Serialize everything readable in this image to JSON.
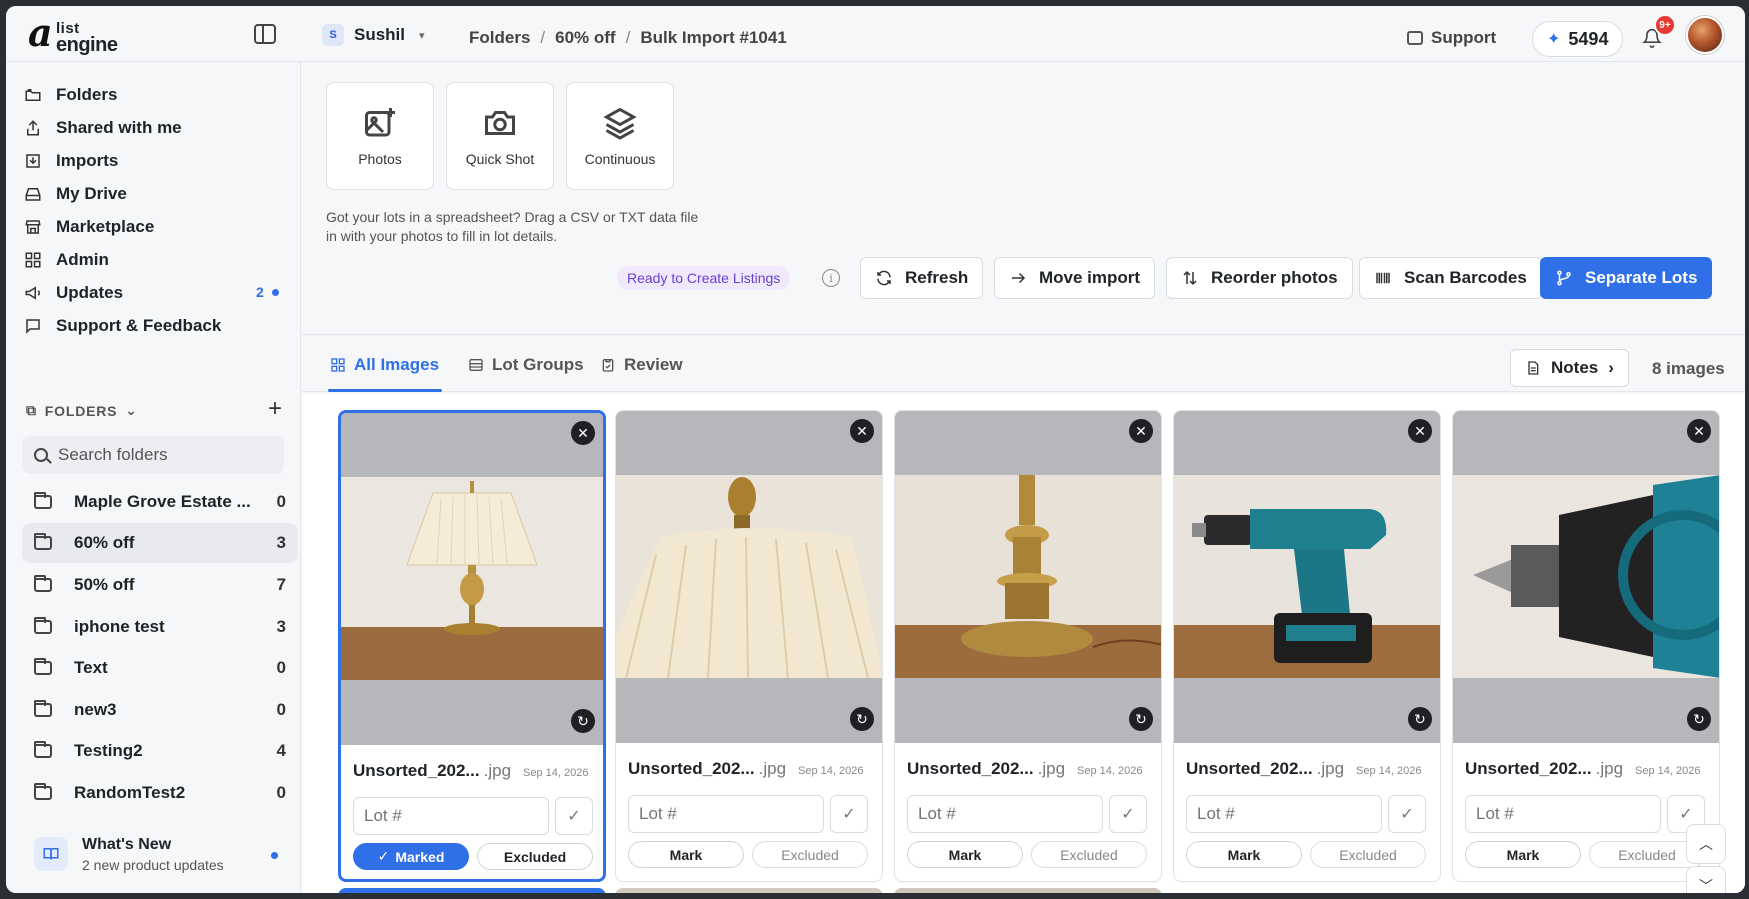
{
  "app": {
    "logo_top": "list",
    "logo_bottom": "engine",
    "logo_mark": "a"
  },
  "topbar": {
    "workspace_initial": "S",
    "workspace_name": "Sushil",
    "breadcrumb": [
      "Folders",
      "60% off",
      "Bulk Import #1041"
    ],
    "support_label": "Support",
    "credits": "5494",
    "notifications_badge": "9+"
  },
  "sidebar": {
    "nav": [
      {
        "label": "Folders",
        "icon": "folders-icon"
      },
      {
        "label": "Shared with me",
        "icon": "share-icon"
      },
      {
        "label": "Imports",
        "icon": "import-icon"
      },
      {
        "label": "My Drive",
        "icon": "drive-icon"
      },
      {
        "label": "Marketplace",
        "icon": "store-icon"
      },
      {
        "label": "Admin",
        "icon": "grid-icon"
      },
      {
        "label": "Updates",
        "icon": "megaphone-icon",
        "badge": "2"
      },
      {
        "label": "Support & Feedback",
        "icon": "chat-icon"
      }
    ],
    "folders_header": "FOLDERS",
    "search_placeholder": "Search folders",
    "folders": [
      {
        "name": "Maple Grove Estate ...",
        "count": "0"
      },
      {
        "name": "60% off",
        "count": "3",
        "active": true
      },
      {
        "name": "50% off",
        "count": "7"
      },
      {
        "name": "iphone test",
        "count": "3"
      },
      {
        "name": "Text",
        "count": "0"
      },
      {
        "name": "new3",
        "count": "0"
      },
      {
        "name": "Testing2",
        "count": "4"
      },
      {
        "name": "RandomTest2",
        "count": "0"
      }
    ],
    "whats_new": {
      "title": "What's New",
      "subtitle": "2 new product updates"
    }
  },
  "upload": {
    "tiles": [
      {
        "label": "Photos",
        "icon": "image-plus-icon"
      },
      {
        "label": "Quick Shot",
        "icon": "camera-icon"
      },
      {
        "label": "Continuous",
        "icon": "layers-icon"
      }
    ],
    "help_text": "Got your lots in a spreadsheet? Drag a CSV or TXT data file in with your photos to fill in lot details."
  },
  "actions": {
    "status": "Ready to Create Listings",
    "buttons": [
      {
        "label": "Refresh",
        "icon": "refresh-icon"
      },
      {
        "label": "Move import",
        "icon": "arrow-right-icon"
      },
      {
        "label": "Reorder photos",
        "icon": "sort-icon"
      },
      {
        "label": "Scan Barcodes",
        "icon": "barcode-icon"
      },
      {
        "label": "Separate Lots",
        "icon": "split-icon",
        "primary": true
      }
    ]
  },
  "tabs": {
    "items": [
      {
        "label": "All Images",
        "icon": "grid-icon",
        "active": true
      },
      {
        "label": "Lot Groups",
        "icon": "list-icon"
      },
      {
        "label": "Review",
        "icon": "clipboard-icon"
      }
    ],
    "notes_label": "Notes",
    "image_count": "8 images"
  },
  "cards": [
    {
      "name": "Unsorted_202...",
      "ext": ".jpg",
      "date": "Sep 14, 2026",
      "lot_placeholder": "Lot #",
      "mark": "Marked",
      "exclude": "Excluded",
      "marked": true,
      "subject": "lamp"
    },
    {
      "name": "Unsorted_202...",
      "ext": ".jpg",
      "date": "Sep 14, 2026",
      "lot_placeholder": "Lot #",
      "mark": "Mark",
      "exclude": "Excluded",
      "marked": false,
      "subject": "lampshade"
    },
    {
      "name": "Unsorted_202...",
      "ext": ".jpg",
      "date": "Sep 14, 2026",
      "lot_placeholder": "Lot #",
      "mark": "Mark",
      "exclude": "Excluded",
      "marked": false,
      "subject": "lamp-base"
    },
    {
      "name": "Unsorted_202...",
      "ext": ".jpg",
      "date": "Sep 14, 2026",
      "lot_placeholder": "Lot #",
      "mark": "Mark",
      "exclude": "Excluded",
      "marked": false,
      "subject": "drill"
    },
    {
      "name": "Unsorted_202...",
      "ext": ".jpg",
      "date": "Sep 14, 2026",
      "lot_placeholder": "Lot #",
      "mark": "Mark",
      "exclude": "Excluded",
      "marked": false,
      "subject": "drill-chuck"
    }
  ],
  "colors": {
    "accent": "#2f6fe8",
    "status_bg": "#efe9fb",
    "status_text": "#6b3fd4",
    "badge_red": "#e53935"
  }
}
